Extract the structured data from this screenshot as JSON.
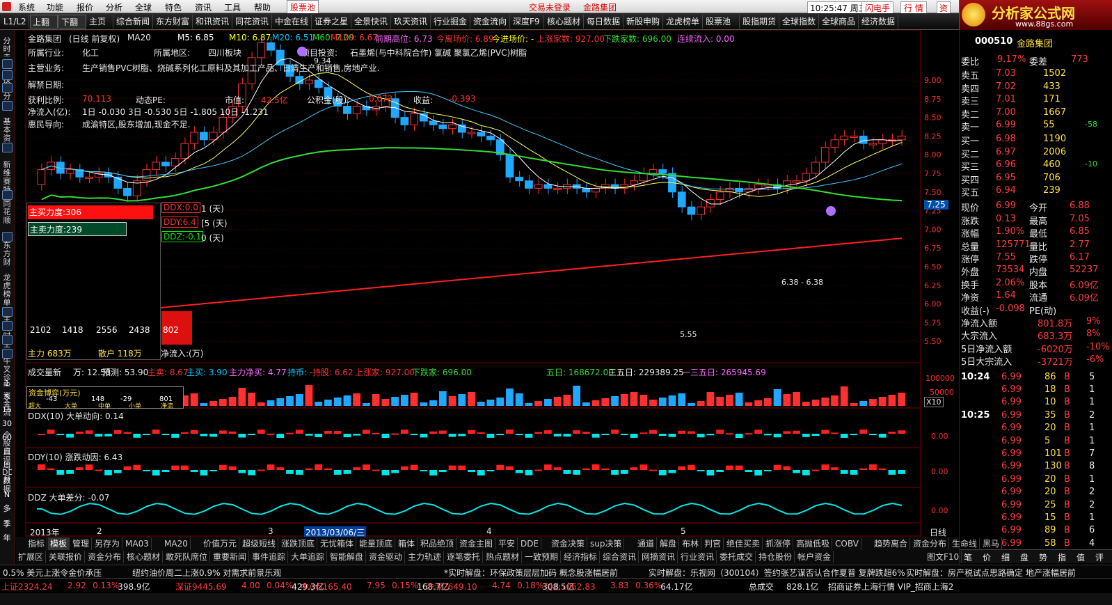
{
  "menu": {
    "items": [
      "系统",
      "功能",
      "报价",
      "分析",
      "全球",
      "特色",
      "资讯",
      "工具",
      "帮助"
    ],
    "active_tab": "股票池",
    "login": "交易未登录",
    "stock": "金路集团",
    "time": "10:25:47 周三",
    "flash": "闪电手",
    "quote": "行 情",
    "asset": "资"
  },
  "logo": {
    "text": "分析家公式网",
    "url": "www.88gs.com"
  },
  "toolbar": {
    "items": [
      "L1/L2",
      "上翻",
      "下翻",
      "主页",
      "综合新闻",
      "东方财富",
      "和讯资讯",
      "同花资讯",
      "中金在线",
      "证券之星",
      "全景快讯",
      "玖天资讯",
      "行业掘金",
      "资金流向",
      "深度F9",
      "核心题材",
      "每日数据",
      "新股申购",
      "龙虎榜单",
      "股票池",
      "股指期货",
      "全球指数",
      "全球商品",
      "经济数据"
    ]
  },
  "leftbar": {
    "groups": [
      "分时走势",
      "技术分析",
      "基本资料",
      "新维赛特",
      "同花顺",
      "东方财富",
      "龙虎榜单",
      "主力时空",
      "牛叉诊股",
      "资金流",
      "个股点评",
      "DDE数据"
    ],
    "periods": [
      "1",
      "5",
      "15",
      "30",
      "60",
      "日",
      "周",
      "月",
      "N",
      "多",
      "季",
      "年"
    ]
  },
  "chart": {
    "header": {
      "name": "金路集团",
      "mode": "(日线 前复权)",
      "ma20": "MA20",
      "m5": "M5: 6.85",
      "m10": "M10: 6.87",
      "m20": "M20: 6.51",
      "m60": "M60: 7.09",
      "m120": "M120: 6.67",
      "prev_high": "前期高位: 6.73",
      "today_cost": "今离场价: 6.89",
      "entry": "今进场价: -",
      "rise": "上涨家数: 927.00",
      "fall": "下跌家数: 696.00",
      "inflow": "连续流入: 0.00"
    },
    "info": {
      "industry_label": "所属行业:",
      "industry": "化工",
      "region_label": "所属地区:",
      "region": "四川板块",
      "invest_label": "项目投资:",
      "invest": "石墨烯(与中科院合作) 氯碱 聚氯乙烯(PVC)树脂",
      "biz_label": "主营业务:",
      "biz": "生产销售PVC树脂、烧碱系列化工原料及其加工产品、日清生产和销售,房地产业.",
      "unban_label": "解禁日期:",
      "profit_label": "获利比例:",
      "profit": "70.113",
      "pe_label": "动态PE:",
      "mcap_label": "市值:",
      "mcap": "42.5亿",
      "accum_label": "公积金(股):",
      "accum": "0.073",
      "earn_label": "收益:",
      "earn": "-0.393",
      "flow_label": "净流入(亿):",
      "flow": "1日 -0.030   3日 -0.530   5日 -1.805   10日 -1.231",
      "guide_label": "惠民导向:",
      "guide": "成渝特区,股东增加,现金不足."
    },
    "price_labels": [
      "9.00",
      "8.75",
      "8.50",
      "8.25",
      "8.00",
      "7.75",
      "7.50",
      "7.25",
      "7.00",
      "6.75",
      "6.50",
      "6.25",
      "6.00",
      "5.75",
      "5.50"
    ],
    "current_tag": "7.25",
    "high_mark": "9.34",
    "low_mark": "5.55",
    "mid_mark": "6.38 - 6.38",
    "ddx_tags": [
      "DDX:0.0",
      "DDY:6.4",
      "DDZ:-0.1"
    ],
    "ddx_suffix": [
      "1 (天)",
      "[5 (天)",
      "0 (天)"
    ],
    "force": {
      "buy": "主买力度:306",
      "sell": "主卖力度:239",
      "bars": [
        "2102",
        "1418",
        "2556",
        "2438",
        "802"
      ],
      "main": "主力 683万",
      "retail": "散户 118万",
      "net": "净流入:(万)"
    },
    "vol_header": {
      "title": "成交量新",
      "wan": "万: 12.58",
      "pred": "预测: 53.90",
      "zhumai": "主卖: 8.67",
      "zhumai2": "主买: 3.90",
      "net": "主力净买: 4.77",
      "hold": "持币: -",
      "holdshares": "持股: 6.62",
      "up": "上涨家: 927.00",
      "down": "下跌家: 696.00",
      "d5": "五日: 168672.00",
      "d35": "三五日: 229389.25",
      "d135": "一三五日: 265945.69"
    },
    "vol_axis": [
      "100000",
      "50000",
      "X10"
    ],
    "fund_box": {
      "title": "资金博弈(万元)",
      "items": [
        "超大",
        "大单",
        "中单",
        "小单",
        "净流"
      ],
      "vals": [
        "-43",
        "148",
        "-29",
        "801"
      ]
    },
    "ddx_line": "DDX(10) 大单动向: 0.14",
    "ddy_line": "DDY(10) 涨跌动因: 6.43",
    "ddz_line": "DDZ 大单差分: -0.07",
    "zero": "0.00",
    "x_labels": [
      "2013年",
      "2",
      "3",
      "2013/03/06/三",
      "4",
      "5"
    ],
    "date_axis": "日线"
  },
  "right": {
    "code": "000510",
    "name": "金路集团",
    "wb_label": "委比",
    "wb": "9.17%",
    "wc_label": "委差",
    "wc": "773",
    "asks": [
      [
        "卖五",
        "7.03",
        "1502",
        ""
      ],
      [
        "卖四",
        "7.02",
        "433",
        ""
      ],
      [
        "卖三",
        "7.01",
        "171",
        ""
      ],
      [
        "卖二",
        "7.00",
        "1667",
        ""
      ],
      [
        "卖一",
        "6.99",
        "55",
        "-58"
      ]
    ],
    "bids": [
      [
        "买一",
        "6.98",
        "1190",
        ""
      ],
      [
        "买二",
        "6.97",
        "2006",
        ""
      ],
      [
        "买三",
        "6.96",
        "460",
        "-10"
      ],
      [
        "买四",
        "6.95",
        "706",
        ""
      ],
      [
        "买五",
        "6.94",
        "239",
        ""
      ]
    ],
    "stats": [
      [
        "现价",
        "6.99",
        "今开",
        "6.88"
      ],
      [
        "涨跌",
        "0.13",
        "最高",
        "7.05"
      ],
      [
        "涨幅",
        "1.90%",
        "最低",
        "6.85"
      ],
      [
        "总量",
        "125771",
        "量比",
        "2.77"
      ],
      [
        "涨停",
        "7.55",
        "跌停",
        "6.17"
      ],
      [
        "外盘",
        "73534",
        "内盘",
        "52237"
      ],
      [
        "换手",
        "2.06%",
        "股本",
        "6.09亿"
      ],
      [
        "净资",
        "1.64",
        "流通",
        "6.09亿"
      ],
      [
        "收益(-)",
        "-0.098",
        "PE(动)",
        ""
      ]
    ],
    "flows": [
      [
        "净流入额",
        "801.8万",
        "9%"
      ],
      [
        "大宗流入",
        "683.3万",
        "8%"
      ],
      [
        "5日净流入额",
        "-6020万",
        "-10%"
      ],
      [
        "5日大宗流入",
        "-3721万",
        "-6%"
      ]
    ],
    "ticks": [
      [
        "10:24",
        "6.99",
        "86",
        "B",
        "5"
      ],
      [
        "",
        "6.99",
        "18",
        "B",
        "1"
      ],
      [
        "",
        "6.99",
        "10",
        "B",
        "1"
      ],
      [
        "10:25",
        "6.99",
        "35",
        "B",
        "2"
      ],
      [
        "",
        "6.99",
        "20",
        "B",
        "1"
      ],
      [
        "",
        "6.99",
        "5",
        "B",
        "1"
      ],
      [
        "",
        "6.99",
        "101",
        "B",
        "7"
      ],
      [
        "",
        "6.99",
        "130",
        "B",
        "8"
      ],
      [
        "",
        "6.99",
        "20",
        "B",
        "1"
      ],
      [
        "",
        "6.99",
        "20",
        "B",
        "2"
      ],
      [
        "",
        "6.99",
        "25",
        "B",
        "2"
      ],
      [
        "",
        "6.99",
        "15",
        "B",
        "1"
      ],
      [
        "",
        "6.99",
        "89",
        "B",
        "6"
      ],
      [
        "",
        "6.99",
        "58",
        "B",
        "4"
      ]
    ],
    "tabs": [
      "笔",
      "价",
      "细",
      "盘",
      "势",
      "指",
      "值",
      "评"
    ]
  },
  "bottom_tabs1": [
    "指标",
    "模板",
    "管理",
    "另存为",
    "MA03",
    "MA20",
    "价值万元",
    "超级短线",
    "涨跌顶底",
    "无忧箱体",
    "能量顶底",
    "箱体",
    "积品绝顶",
    "资金主图",
    "平安",
    "DDE",
    "资金决策",
    "sup决策",
    "通道",
    "解盘",
    "布林",
    "判官",
    "绝佳买卖",
    "抓涨停",
    "高抛低吸",
    "COBV",
    "趋势离合",
    "资金分布",
    "生命线",
    "黑马"
  ],
  "bottom_tabs2": [
    "扩展区",
    "关联报价",
    "资金分布",
    "核心题材",
    "敢死队席位",
    "重要新闻",
    "事件追踪",
    "大单追踪",
    "智能解盘",
    "资金驱动",
    "主力轨迹",
    "逐笔委托",
    "热点题材",
    "一致预期",
    "经济指标",
    "综合资讯",
    "网摘资讯",
    "行业资讯",
    "委托成交",
    "持仓股份",
    "帐户资金"
  ],
  "graph_tab": "图文F10",
  "ticker": [
    "0.5% 美元上涨令金价承压",
    "纽约油价周二上涨0.9% 对需求前景乐观",
    "*实时解盘：环保政策层层加码 概念股涨幅居前",
    "实时解盘：乐视网（300104）签约张艺谋否认合作夏普 复牌跌超6%",
    "实时解盘：房产税试点思路确定 地产涨幅居前"
  ],
  "status": [
    [
      "上证2324.24",
      "2.92",
      "0.13%",
      "398.9亿"
    ],
    [
      "深证9445.69",
      "4.00",
      "0.04%",
      "429.3亿"
    ],
    [
      "中小5165.40",
      "7.95",
      "0.15%",
      "168.7亿"
    ],
    [
      "沪深2649.10",
      "4.74",
      "0.18%",
      "308.5亿"
    ],
    [
      "创业1062.83",
      "3.83",
      "0.36%",
      "64.17亿"
    ]
  ],
  "status_tail": [
    "总成交",
    "828.1亿",
    "招商证券上海行情 VIP_招商上海2"
  ],
  "colors": {
    "up": "#ff3c3c",
    "down": "#00c8ff",
    "ma_green": "#33dd33",
    "ma_red": "#ff2020",
    "grid_red": "#7a0000"
  }
}
